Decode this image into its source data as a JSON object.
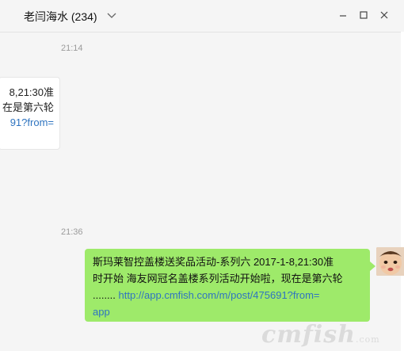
{
  "header": {
    "title": "老闫海水",
    "count": "(234)"
  },
  "window": {
    "minimize_icon": "minimize-icon",
    "maximize_icon": "maximize-icon",
    "close_icon": "close-icon"
  },
  "messages": {
    "time_1": "21:14",
    "received": {
      "line1": "8,21:30准",
      "line2": "在是第六轮",
      "link_fragment": "91?from="
    },
    "time_2": "21:36",
    "sent": {
      "line1": "斯玛莱智控盖楼送奖品活动-系列六 2017-1-8,21:30准",
      "line2": "时开始 海友网冠名盖楼系列活动开始啦，现在是第六轮",
      "dots": "........",
      "link": " http://app.cmfish.com/m/post/475691?from=",
      "link_tail": "app"
    }
  },
  "watermark": {
    "text": "cmfish",
    "suffix": ".com"
  },
  "colors": {
    "sent_bubble": "#9eea6a",
    "link": "#2f74c0",
    "background": "#f5f5f5"
  }
}
